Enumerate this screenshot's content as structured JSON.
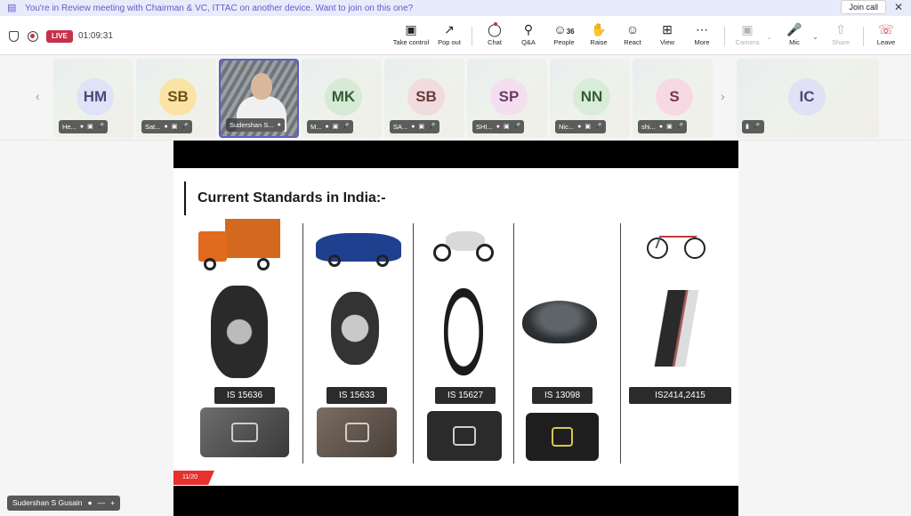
{
  "banner": {
    "text": "You're in Review meeting with Chairman & VC, ITTAC on another device. Want to join on this one?",
    "join_label": "Join call",
    "close_glyph": "✕"
  },
  "toolbar": {
    "live_label": "LIVE",
    "timer": "01:09:31",
    "buttons": {
      "take_control": "Take control",
      "pop_out": "Pop out",
      "chat": "Chat",
      "qa": "Q&A",
      "people": "People",
      "people_count": "36",
      "raise": "Raise",
      "react": "React",
      "view": "View",
      "more": "More",
      "camera": "Camera",
      "mic": "Mic",
      "share": "Share",
      "leave": "Leave"
    }
  },
  "participants": [
    {
      "initials": "HM",
      "name": "He...",
      "color": "#dfe3f7",
      "text_color": "#4a4a7a"
    },
    {
      "initials": "SB",
      "name": "Sat...",
      "color": "#fbe3a6",
      "text_color": "#6b5212"
    },
    {
      "initials": "",
      "name": "Sudershan S...",
      "color": "",
      "text_color": ""
    },
    {
      "initials": "MK",
      "name": "M...",
      "color": "#d6ead6",
      "text_color": "#355c35"
    },
    {
      "initials": "SB",
      "name": "SA...",
      "color": "#f0dcdc",
      "text_color": "#6b3b3b"
    },
    {
      "initials": "SP",
      "name": "SHI...",
      "color": "#f4dff0",
      "text_color": "#6b3b64"
    },
    {
      "initials": "NN",
      "name": "Nic...",
      "color": "#d9ecd9",
      "text_color": "#355c35"
    },
    {
      "initials": "S",
      "name": "shi...",
      "color": "#f7d9e4",
      "text_color": "#7a3350"
    },
    {
      "initials": "IC",
      "name": "",
      "color": "#e2e0f4",
      "text_color": "#4a4a7a"
    }
  ],
  "slide": {
    "title": "Current Standards in India:-",
    "standards": [
      "IS 15636",
      "IS 15633",
      "IS 15627",
      "IS 13098",
      "IS2414,2415"
    ],
    "page": "11/20"
  },
  "self_view": {
    "name": "Sudershan S Gusain"
  },
  "icons": {
    "banner": "calendar-people-icon",
    "shield": "shield-icon",
    "record": "record-icon"
  },
  "colors": {
    "accent": "#5b5fc7",
    "live": "#c4314b",
    "leave": "#c4314b",
    "page_tag": "#e5322d"
  }
}
